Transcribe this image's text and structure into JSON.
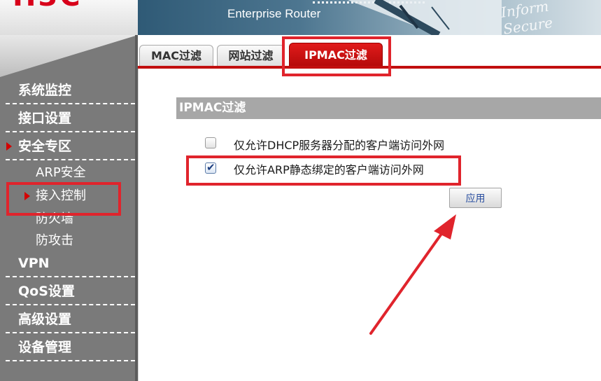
{
  "header": {
    "logo_text": "H3C",
    "banner_title": "Enterprise Router",
    "banner_script": "Inform Secure"
  },
  "sidebar": {
    "items": [
      {
        "label": "系统监控"
      },
      {
        "label": "接口设置"
      },
      {
        "label": "安全专区",
        "expanded": true
      },
      {
        "label": "VPN"
      },
      {
        "label": "QoS设置"
      },
      {
        "label": "高级设置"
      },
      {
        "label": "设备管理"
      }
    ],
    "sub_items": [
      {
        "label": "ARP安全"
      },
      {
        "label": "接入控制",
        "selected": true
      },
      {
        "label": "防火墙"
      },
      {
        "label": "防攻击"
      }
    ]
  },
  "tabs": [
    {
      "label": "MAC过滤"
    },
    {
      "label": "网站过滤"
    },
    {
      "label": "IPMAC过滤",
      "active": true
    }
  ],
  "main": {
    "section_title": "IPMAC过滤",
    "options": [
      {
        "label": "仅允许DHCP服务器分配的客户端访问外网",
        "checked": false
      },
      {
        "label": "仅允许ARP静态绑定的客户端访问外网",
        "checked": true
      }
    ],
    "apply_label": "应用"
  },
  "colors": {
    "accent_red": "#c20f0f",
    "annotation_red": "#e0242c",
    "sidebar_bg": "#7a7a7a",
    "section_header_bg": "#a7a7a7"
  },
  "icons": [
    "check-icon",
    "menu-arrow-icon",
    "pointer-arrow-icon"
  ]
}
